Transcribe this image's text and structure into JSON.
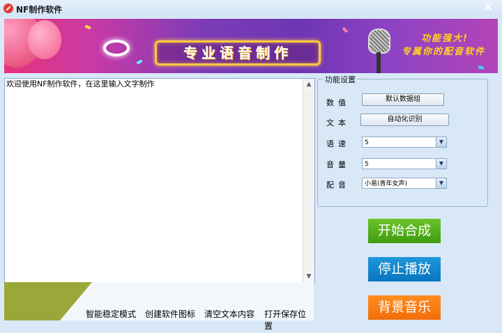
{
  "window": {
    "title": "NF制作软件",
    "close_glyph": "✕"
  },
  "banner": {
    "title": "专业语音制作",
    "slogan_line1": "功能强大!",
    "slogan_line2": "专属你的配音软件"
  },
  "editor": {
    "text": "欢迎使用NF制作软件，在这里输入文字制作"
  },
  "settings": {
    "legend": "功能设置",
    "rows": [
      {
        "label": "数值",
        "button": "默认数据组"
      },
      {
        "label": "文本",
        "button": "自动化识别"
      },
      {
        "label": "语速",
        "value": "5"
      },
      {
        "label": "音量",
        "value": "5"
      },
      {
        "label": "配音",
        "value": "小易(青年女声)"
      }
    ]
  },
  "actions": {
    "start": "开始合成",
    "stop": "停止播放",
    "music": "背景音乐"
  },
  "bottom_links": [
    "智能稳定模式",
    "创建软件图标",
    "清空文本内容",
    "打开保存位置"
  ],
  "colors": {
    "start": "#54b31f",
    "stop": "#1288cf",
    "music": "#f77a12",
    "banner_purple": "#7d3cb7"
  }
}
